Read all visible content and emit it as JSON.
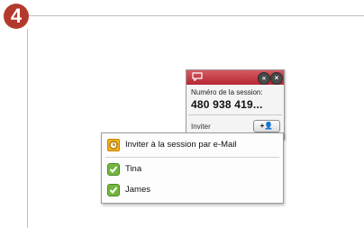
{
  "step": {
    "number": "4"
  },
  "widget": {
    "session_label": "Numéro de la session:",
    "session_number": "480 938 419...",
    "invite_label": "Inviter",
    "invite_button": "+👤",
    "buttons": {
      "collapse": "«",
      "close": "×"
    }
  },
  "menu": {
    "items": [
      {
        "label": "Inviter à la session par e-Mail",
        "icon": "clock-icon"
      },
      {
        "label": "Tina",
        "icon": "check-icon"
      },
      {
        "label": "James",
        "icon": "check-icon"
      }
    ]
  },
  "colors": {
    "badge": "#b23a2c",
    "titlebar": "#b52733",
    "check": "#73b63f",
    "clock": "#f2b120"
  }
}
